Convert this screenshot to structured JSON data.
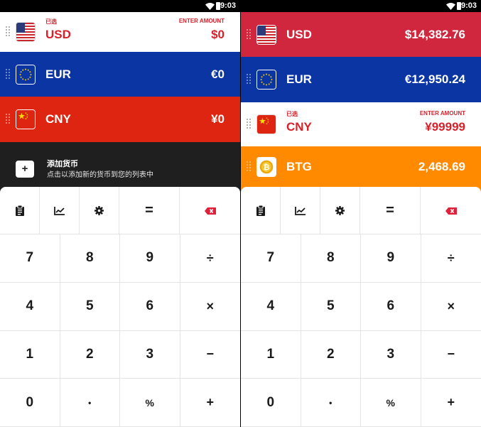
{
  "status": {
    "time": "9:03"
  },
  "screens": [
    {
      "rows": [
        {
          "code": "USD",
          "amount": "$0",
          "selected": true,
          "selected_label": "已选",
          "enter_label": "ENTER AMOUNT",
          "flag": "us-flag-icon",
          "bg": "#ffffff"
        },
        {
          "code": "EUR",
          "amount": "€0",
          "selected": false,
          "flag": "eu-flag-icon",
          "bg": "#0a35a3"
        },
        {
          "code": "CNY",
          "amount": "¥0",
          "selected": false,
          "flag": "cn-flag-icon",
          "bg": "#de2512"
        }
      ],
      "add_row": {
        "title": "添加货币",
        "subtitle": "点击以添加新的货币到您的列表中",
        "button": "+"
      }
    },
    {
      "rows": [
        {
          "code": "USD",
          "amount": "$14,382.76",
          "selected": false,
          "flag": "us-flag-icon",
          "bg": "#d0273e"
        },
        {
          "code": "EUR",
          "amount": "€12,950.24",
          "selected": false,
          "flag": "eu-flag-icon",
          "bg": "#0a35a3"
        },
        {
          "code": "CNY",
          "amount": "¥99999",
          "selected": true,
          "selected_label": "已选",
          "enter_label": "ENTER AMOUNT",
          "flag": "cn-flag-icon",
          "bg": "#ffffff"
        },
        {
          "code": "BTG",
          "amount": "2,468.69",
          "selected": false,
          "flag": "bitcoin-gold-icon",
          "bg": "#ff8a00"
        }
      ]
    }
  ],
  "toolbar": {
    "icons": [
      "clipboard-icon",
      "chart-icon",
      "gear-icon",
      "equals-icon",
      "backspace-icon"
    ],
    "equals": "="
  },
  "keypad": {
    "keys": [
      {
        "label": "7",
        "name": "key-7"
      },
      {
        "label": "8",
        "name": "key-8"
      },
      {
        "label": "9",
        "name": "key-9"
      },
      {
        "label": "÷",
        "name": "key-divide"
      },
      {
        "label": "4",
        "name": "key-4"
      },
      {
        "label": "5",
        "name": "key-5"
      },
      {
        "label": "6",
        "name": "key-6"
      },
      {
        "label": "×",
        "name": "key-multiply"
      },
      {
        "label": "1",
        "name": "key-1"
      },
      {
        "label": "2",
        "name": "key-2"
      },
      {
        "label": "3",
        "name": "key-3"
      },
      {
        "label": "−",
        "name": "key-minus"
      },
      {
        "label": "0",
        "name": "key-0"
      },
      {
        "label": "•",
        "name": "key-decimal"
      },
      {
        "label": "%",
        "name": "key-percent"
      },
      {
        "label": "+",
        "name": "key-plus"
      }
    ]
  },
  "colors": {
    "accent_red": "#d8202b",
    "usd_red": "#d0273e",
    "eur_blue": "#0a35a3",
    "cny_red": "#de2512",
    "btg_orange": "#ff8a00",
    "add_bg": "#1f1f1f"
  }
}
